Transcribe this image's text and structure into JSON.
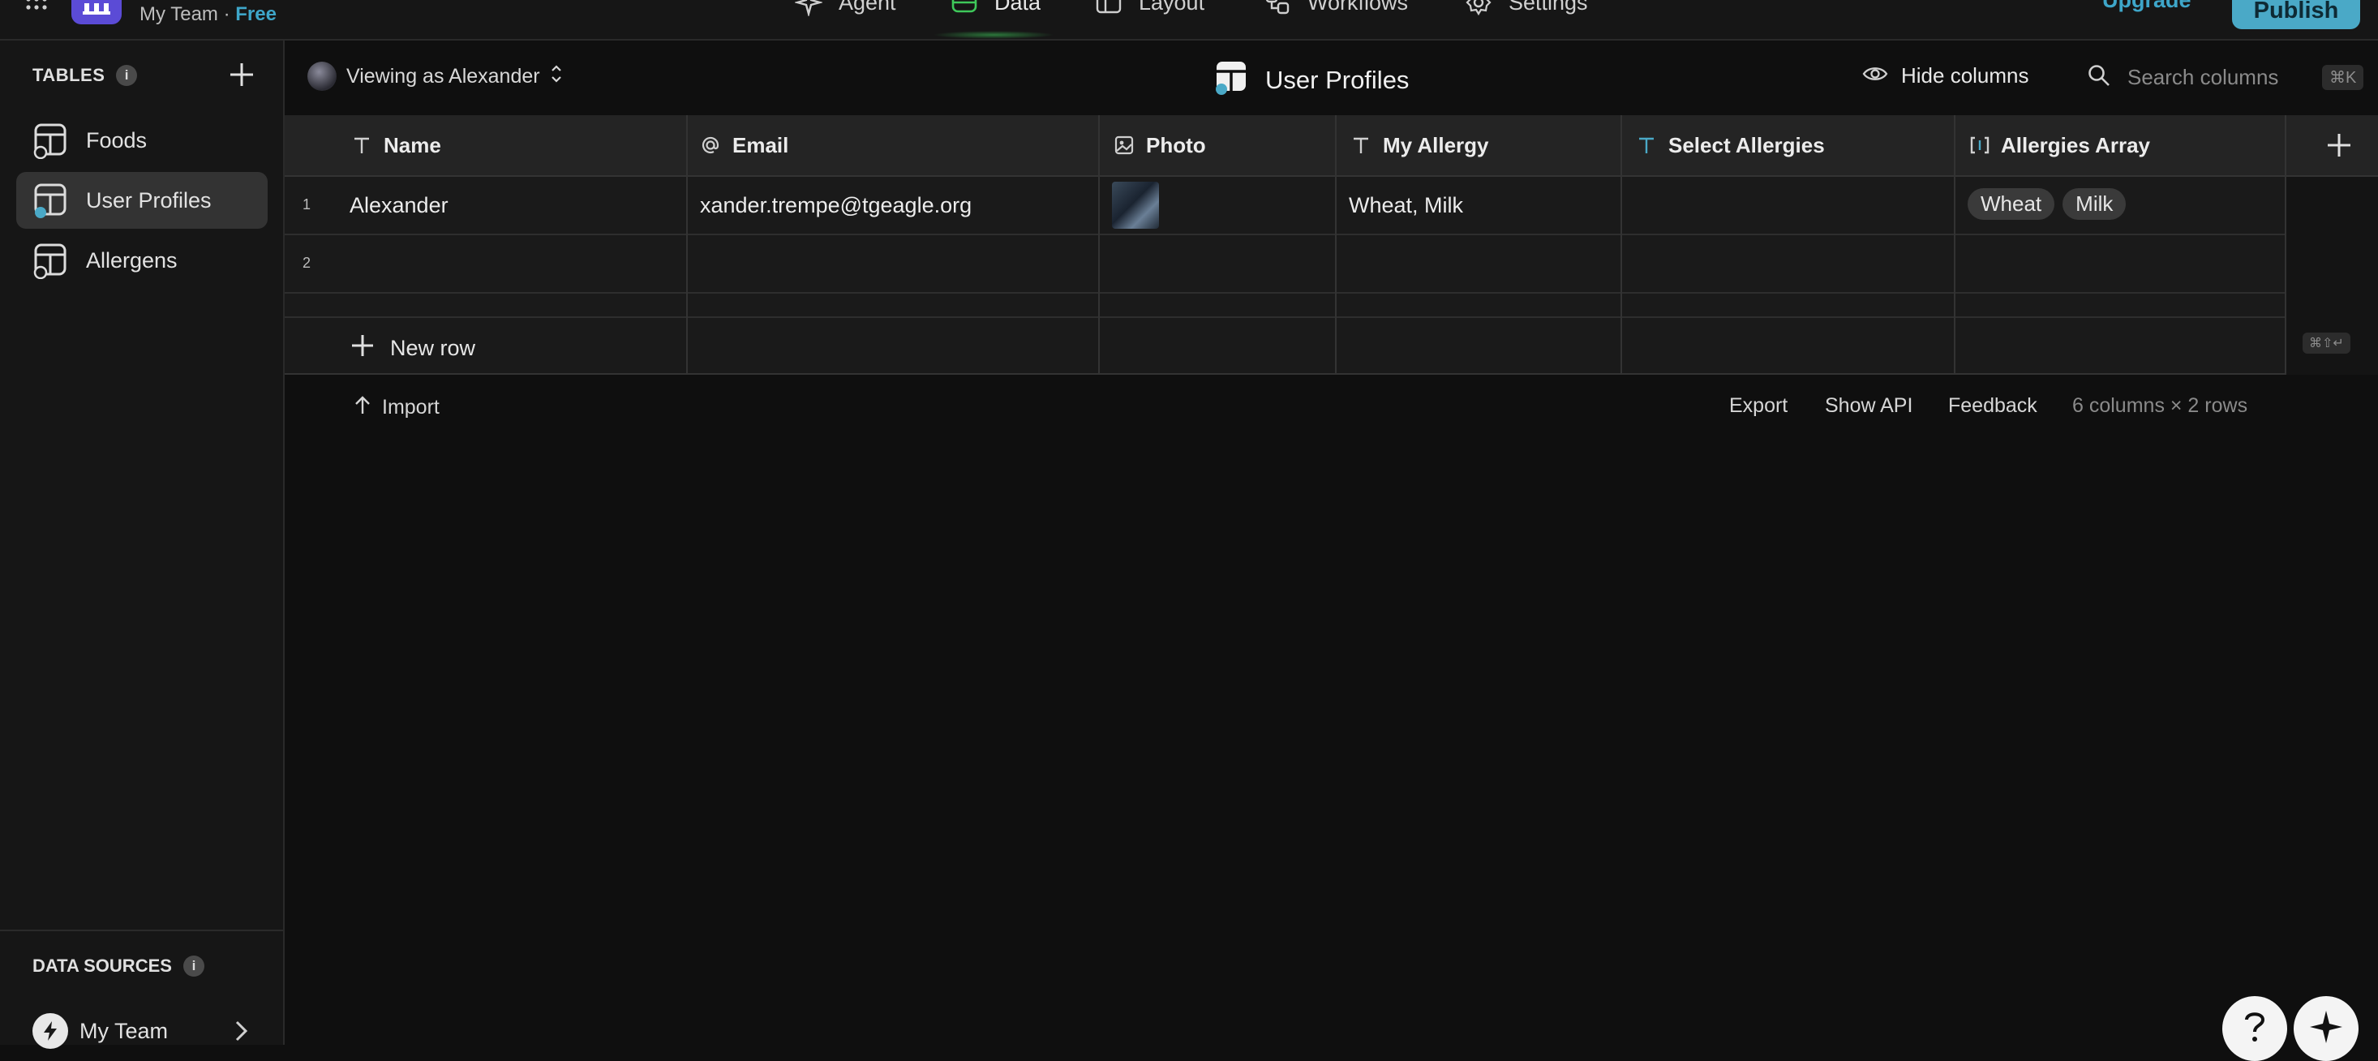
{
  "topbar": {
    "team_name": "My Team",
    "separator": " · ",
    "plan": "Free",
    "nav": [
      {
        "label": "Agent",
        "icon": "sparkle-icon"
      },
      {
        "label": "Data",
        "icon": "database-icon"
      },
      {
        "label": "Layout",
        "icon": "layout-icon"
      },
      {
        "label": "Workflows",
        "icon": "workflow-icon"
      },
      {
        "label": "Settings",
        "icon": "gear-icon"
      }
    ],
    "upgrade_label": "Upgrade",
    "publish_label": "Publish"
  },
  "sidebar": {
    "tables_header": "TABLES",
    "items": [
      {
        "label": "Foods",
        "active": false
      },
      {
        "label": "User Profiles",
        "active": true
      },
      {
        "label": "Allergens",
        "active": false
      }
    ],
    "data_sources_header": "DATA SOURCES",
    "data_source": "My Team"
  },
  "toolbar": {
    "viewing_as": "Viewing as Alexander",
    "table_title": "User Profiles",
    "hide_columns": "Hide columns",
    "search_placeholder": "Search columns",
    "search_shortcut": "⌘K"
  },
  "table": {
    "columns": [
      {
        "label": "Name",
        "icon": "text-type-icon"
      },
      {
        "label": "Email",
        "icon": "at-sign-icon"
      },
      {
        "label": "Photo",
        "icon": "image-icon"
      },
      {
        "label": "My Allergy",
        "icon": "text-type-icon"
      },
      {
        "label": "Select Allergies",
        "icon": "text-type-icon"
      },
      {
        "label": "Allergies Array",
        "icon": "array-icon"
      }
    ],
    "rows": [
      {
        "num": "1",
        "name": "Alexander",
        "email": "xander.trempe@tgeagle.org",
        "my_allergy": "Wheat, Milk",
        "select_allergies": "",
        "allergies_array": [
          "Wheat",
          "Milk"
        ]
      },
      {
        "num": "2",
        "name": "",
        "email": "",
        "my_allergy": "",
        "select_allergies": "",
        "allergies_array": []
      }
    ],
    "new_row_label": "New row",
    "new_row_shortcut": "⌘⇧↵"
  },
  "footer": {
    "import_label": "Import",
    "export_label": "Export",
    "show_api_label": "Show API",
    "feedback_label": "Feedback",
    "stats": "6 columns × 2 rows"
  },
  "colors": {
    "accent": "#4aa9c7",
    "brand_logo": "#5b4bd6",
    "data_tab_glow": "#3ec85a"
  }
}
